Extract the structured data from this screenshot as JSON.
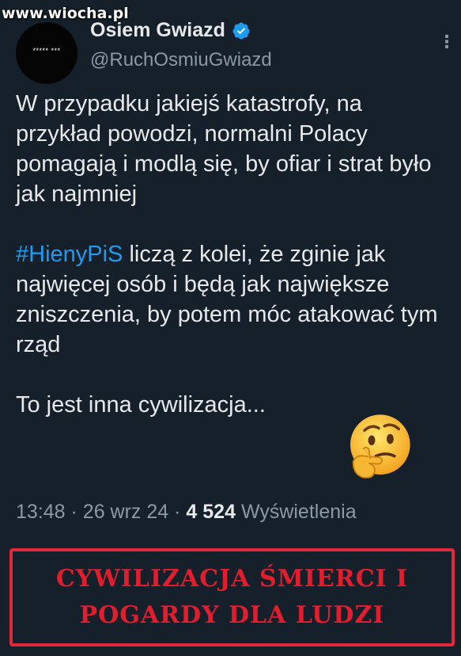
{
  "watermark": "www.wiocha.pl",
  "tweet": {
    "author_name": "Osiem Gwiazd",
    "author_handle": "@RuchOsmiuGwiazd",
    "avatar_text": "***** ***",
    "more_icon": "more-dots-icon",
    "verified_icon": "verified-badge-icon",
    "paragraph1": "W przypadku jakiejś katastrofy, na przykład powodzi, normalni Polacy pomagają i modlą się, by ofiar i strat było jak najmniej",
    "hashtag": "#HienyPiS",
    "paragraph2_rest": " liczą z kolei, że zginie jak najwięcej osób i będą jak największe zniszczenia, by potem móc atakować tym rząd",
    "paragraph3": "To jest inna cywilizacja...",
    "emoji": "thinking-face-emoji",
    "time": "13:48",
    "date": "26 wrz 24",
    "views_count": "4 524",
    "views_label": "Wyświetlenia"
  },
  "banner": {
    "line1": "CYWILIZACJA ŚMIERCI I",
    "line2": "POGARDY DLA LUDZI"
  },
  "colors": {
    "background": "#15202b",
    "hashtag": "#1d9bf0",
    "verified": "#1d9bf0",
    "banner_red": "#e11d2e"
  }
}
